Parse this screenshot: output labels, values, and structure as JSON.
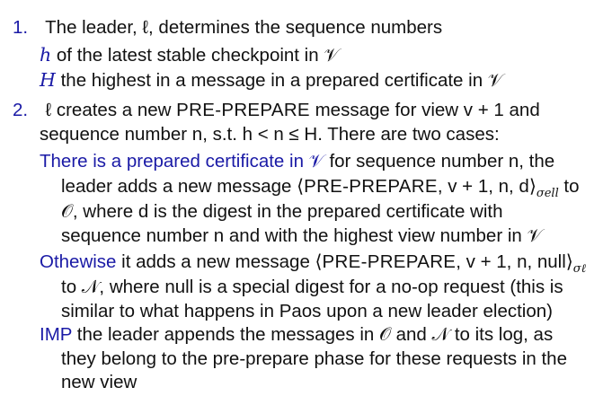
{
  "items": [
    {
      "number": "1.",
      "lines": [
        "The leader, ℓ, determines the sequence numbers"
      ],
      "subs": [
        {
          "term": "h",
          "text": "of the latest stable checkpoint in 𝒱"
        },
        {
          "term": "H",
          "text": "the highest in a message in a prepared certificate in 𝒱"
        }
      ]
    },
    {
      "number": "2.",
      "line1_a": "ℓ creates a new ",
      "line1_sc": "PRE-PREPARE",
      "line1_b": " message for view v + 1 and",
      "line2": "sequence number n, s.t. h < n ≤ H. There are two cases:",
      "case1_term": "There is a prepared certificate in 𝒱",
      "case1_rest": " for sequence number n, the",
      "case1_l2_a": "leader adds a new message ⟨",
      "case1_l2_sc": "PRE-PREPARE",
      "case1_l2_b": ", v + 1, n, d⟩",
      "case1_l2_sub": "σell",
      "case1_l2_c": " to",
      "case1_l3": "𝒪, where d is the digest in the prepared certificate with",
      "case1_l4": "sequence number n and with the highest view number in 𝒱",
      "case2_term": "Othewise",
      "case2_l1_a": " it adds a new message ⟨",
      "case2_l1_sc": "PRE-PREPARE",
      "case2_l1_b": ", v + 1, n, null⟩",
      "case2_l1_sub": "σℓ",
      "case2_l2": "to 𝒩, where null is a special digest for a no-op request (this is",
      "case2_l3": "similar to what happens in Paos upon a new leader election)",
      "imp_term": "IMP",
      "imp_l1": " the leader appends the messages in 𝒪 and 𝒩 to its log, as",
      "imp_l2": "they belong to the pre-prepare phase for these requests in the",
      "imp_l3": "new view"
    }
  ]
}
